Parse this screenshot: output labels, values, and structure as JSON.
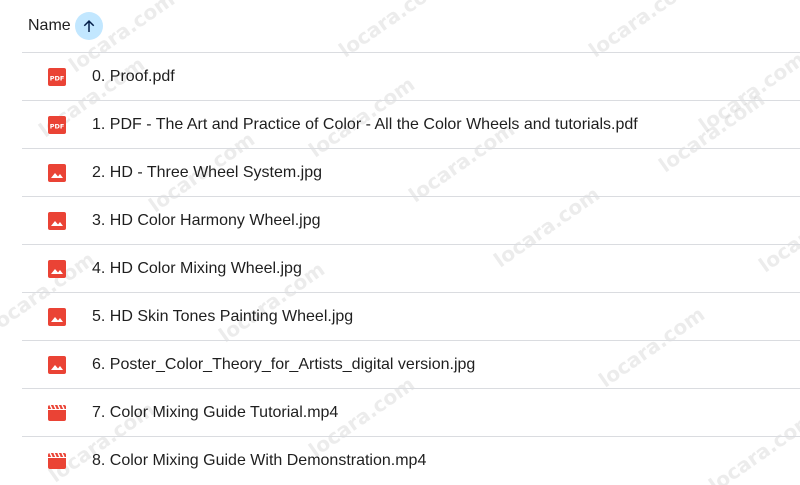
{
  "header": {
    "name_label": "Name",
    "sort_icon": "arrow-up-icon"
  },
  "files": [
    {
      "name": "0. Proof.pdf",
      "type": "pdf",
      "icon": "pdf-icon"
    },
    {
      "name": "1. PDF - The Art and Practice of Color - All the Color Wheels and tutorials.pdf",
      "type": "pdf",
      "icon": "pdf-icon"
    },
    {
      "name": "2. HD - Three Wheel System.jpg",
      "type": "image",
      "icon": "image-icon"
    },
    {
      "name": "3. HD Color Harmony Wheel.jpg",
      "type": "image",
      "icon": "image-icon"
    },
    {
      "name": "4. HD Color Mixing Wheel.jpg",
      "type": "image",
      "icon": "image-icon"
    },
    {
      "name": "5. HD Skin Tones Painting Wheel.jpg",
      "type": "image",
      "icon": "image-icon"
    },
    {
      "name": "6. Poster_Color_Theory_for_Artists_digital version.jpg",
      "type": "image",
      "icon": "image-icon"
    },
    {
      "name": "7. Color Mixing Guide Tutorial.mp4",
      "type": "video",
      "icon": "video-icon"
    },
    {
      "name": "8. Color Mixing Guide With Demonstration.mp4",
      "type": "video",
      "icon": "video-icon"
    }
  ],
  "colors": {
    "file_icon_red": "#ea4335",
    "sort_highlight": "#c2e7ff",
    "sort_arrow": "#041e49"
  },
  "watermark": {
    "text": "locara.com"
  }
}
